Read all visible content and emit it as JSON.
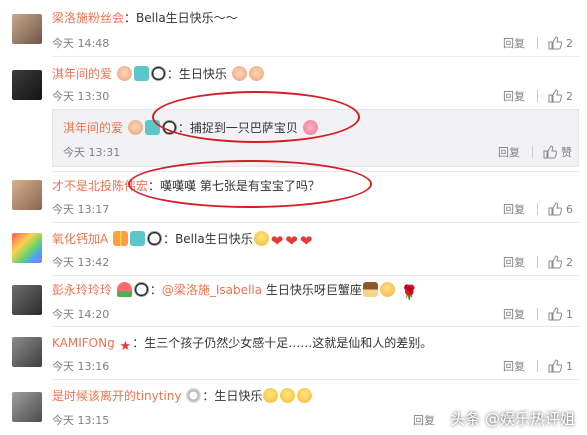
{
  "comments": [
    {
      "name": "梁洛施粉丝会",
      "text": "Bella生日快乐～～",
      "time": "今天 14:48",
      "reply": "回复",
      "likes": "2"
    },
    {
      "name": "淇年间的爱",
      "text": "生日快乐",
      "time": "今天 13:30",
      "reply": "回复",
      "likes": "2",
      "quote": {
        "name": "淇年间的爱",
        "text": "捕捉到一只巴萨宝贝",
        "time": "今天 13:31",
        "reply": "回复",
        "likes": "赞"
      }
    },
    {
      "name": "才不是北投陈伟宏",
      "text": "嘆嘆嘆 第七张是有宝宝了吗？",
      "time": "今天 13:17",
      "reply": "回复",
      "likes": "6"
    },
    {
      "name": "氧化钙加A",
      "text": "Bella生日快乐",
      "time": "今天 13:42",
      "reply": "回复",
      "likes": "2"
    },
    {
      "name": "彭永玲玲玲",
      "mention": "@梁洛施_Isabella",
      "text": "生日快乐呀巨蟹座",
      "time": "今天 14:20",
      "reply": "回复",
      "likes": "1"
    },
    {
      "name": "KAMIFONg",
      "text": "生三个孩子仍然少女感十足……这就是仙和人的差别。",
      "time": "今天 13:16",
      "reply": "回复",
      "likes": "1"
    },
    {
      "name": "是时候该离开的tinytiny",
      "text": "生日快乐",
      "time": "今天 13:15",
      "reply": "回复",
      "likes": "1"
    }
  ],
  "colon": "：",
  "watermark": "头条 @娱乐热评姐",
  "colors": {
    "name": "#eb7350",
    "annotation": "#d21f26",
    "meta": "#808080"
  }
}
